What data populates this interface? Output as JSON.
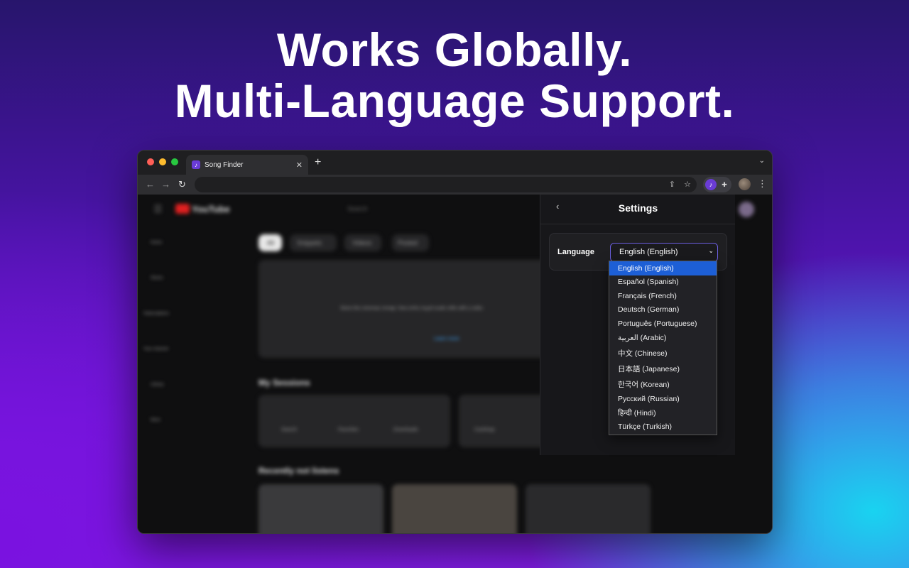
{
  "headline": {
    "line1": "Works Globally.",
    "line2": "Multi-Language Support."
  },
  "browser": {
    "tab_title": "Song Finder",
    "tab_favicon": "music-note-icon",
    "new_tab_label": "+",
    "tab_close_label": "✕"
  },
  "page": {
    "logo_text": "YouTube",
    "search_placeholder": "Search",
    "chips": [
      "All",
      "Snippets",
      "Videos",
      "Posted"
    ],
    "section1": "My Sessions",
    "section2": "Recently not listens",
    "cards": [
      "Search",
      "Favorites",
      "Downloads",
      "Cashtrap"
    ],
    "sidebar": [
      "Home",
      "Shorts",
      "Subscriptions",
      "Your channel",
      "Library",
      "More"
    ],
    "banner_text": "Store the cinemas mmap: hew enhs myyd scale relle with a sebs",
    "banner_link": "Learn more"
  },
  "settings": {
    "title": "Settings",
    "language_label": "Language",
    "selected_language": "English (English)",
    "options": [
      "English (English)",
      "Español (Spanish)",
      "Français (French)",
      "Deutsch (German)",
      "Português (Portuguese)",
      "العربية (Arabic)",
      "中文 (Chinese)",
      "日本語 (Japanese)",
      "한국어 (Korean)",
      "Русский (Russian)",
      "हिन्दी (Hindi)",
      "Türkçe (Turkish)"
    ]
  },
  "colors": {
    "accent": "#6a3cd6",
    "selected_option": "#1d5fd6"
  }
}
